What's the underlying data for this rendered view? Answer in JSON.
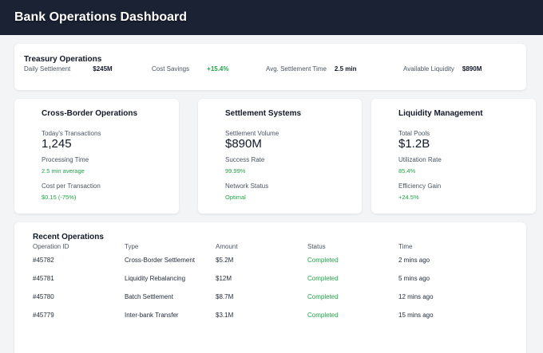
{
  "header": {
    "title": "Bank Operations Dashboard"
  },
  "treasury": {
    "title": "Treasury Operations",
    "metrics": [
      {
        "label": "Daily Settlement",
        "value": "$245M"
      },
      {
        "label": "Cost Savings",
        "value": "+15.4%"
      },
      {
        "label": "Avg. Settlement Time",
        "value": "2.5 min"
      },
      {
        "label": "Available Liquidity",
        "value": "$890M"
      }
    ]
  },
  "cross_border": {
    "title": "Cross-Border Operations",
    "transactions_label": "Today's Transactions",
    "transactions_value": "1,245",
    "processing_label": "Processing Time",
    "processing_value": "2.5 min average",
    "cost_label": "Cost per Transaction",
    "cost_value": "$0.15 (-75%)"
  },
  "settlement": {
    "title": "Settlement Systems",
    "volume_label": "Settlement Volume",
    "volume_value": "$890M",
    "success_label": "Success Rate",
    "success_value": "99.99%",
    "network_label": "Network Status",
    "network_value": "Optimal"
  },
  "liquidity": {
    "title": "Liquidity Management",
    "pools_label": "Total Pools",
    "pools_value": "$1.2B",
    "utilization_label": "Utilization Rate",
    "utilization_value": "85.4%",
    "efficiency_label": "Efficiency Gain",
    "efficiency_value": "+24.5%"
  },
  "recent": {
    "title": "Recent Operations",
    "columns": [
      "Operation ID",
      "Type",
      "Amount",
      "Status",
      "Time"
    ],
    "rows": [
      [
        "#45782",
        "Cross-Border Settlement",
        "$5.2M",
        "Completed",
        "2 mins ago"
      ],
      [
        "#45781",
        "Liquidity Rebalancing",
        "$12M",
        "Completed",
        "5 mins ago"
      ],
      [
        "#45780",
        "Batch Settlement",
        "$8.7M",
        "Completed",
        "12 mins ago"
      ],
      [
        "#45779",
        "Inter-bank Transfer",
        "$3.1M",
        "Completed",
        "15 mins ago"
      ]
    ]
  },
  "colors": {
    "header_bg": "#1a2234",
    "positive": "#22a447",
    "page_bg": "#f3f4f6"
  }
}
